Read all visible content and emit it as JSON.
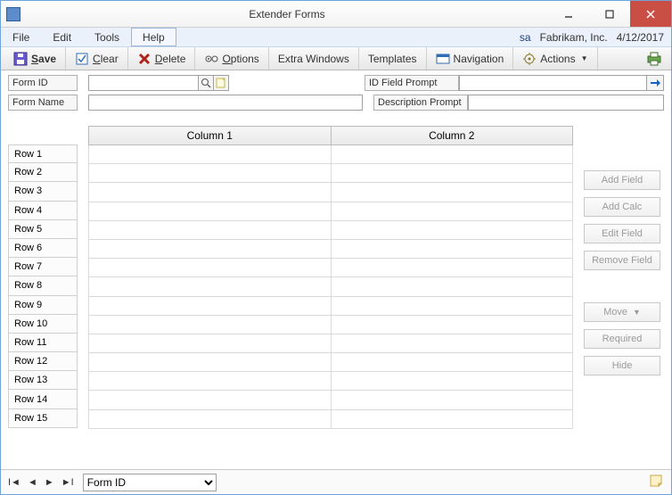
{
  "window": {
    "title": "Extender Forms"
  },
  "menubar": {
    "items": [
      "File",
      "Edit",
      "Tools",
      "Help"
    ],
    "user": "sa",
    "company": "Fabrikam, Inc.",
    "date": "4/12/2017"
  },
  "toolbar": {
    "save": "Save",
    "clear": "Clear",
    "delete": "Delete",
    "options": "Options",
    "extra_windows": "Extra Windows",
    "templates": "Templates",
    "navigation": "Navigation",
    "actions": "Actions"
  },
  "form": {
    "form_id_label": "Form ID",
    "form_id_value": "",
    "form_name_label": "Form Name",
    "form_name_value": "",
    "id_prompt_label": "ID Field Prompt",
    "id_prompt_value": "",
    "desc_prompt_label": "Description Prompt",
    "desc_prompt_value": ""
  },
  "grid": {
    "col1": "Column 1",
    "col2": "Column 2",
    "rows": [
      "Row 1",
      "Row 2",
      "Row 3",
      "Row 4",
      "Row 5",
      "Row 6",
      "Row 7",
      "Row 8",
      "Row 9",
      "Row 10",
      "Row 11",
      "Row 12",
      "Row 13",
      "Row 14",
      "Row 15"
    ]
  },
  "side": {
    "add_field": "Add Field",
    "add_calc": "Add Calc",
    "edit_field": "Edit Field",
    "remove_field": "Remove Field",
    "move": "Move",
    "required": "Required",
    "hide": "Hide"
  },
  "bottom": {
    "sort": "Form ID"
  }
}
